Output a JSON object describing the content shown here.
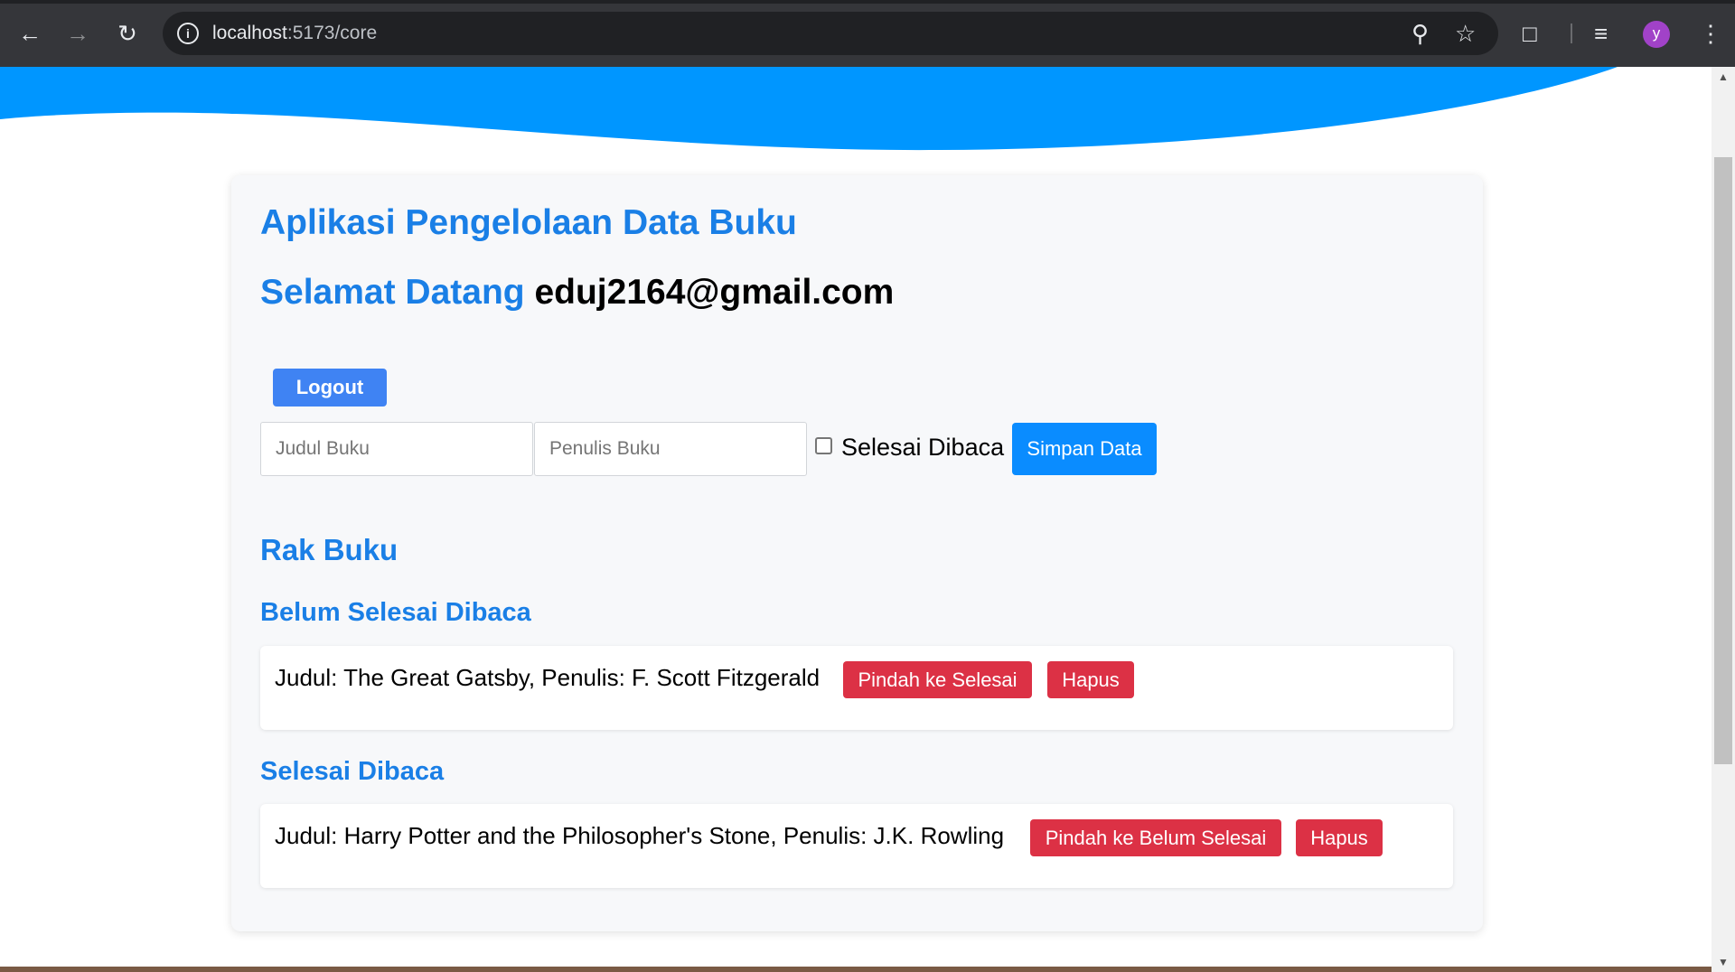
{
  "browser": {
    "url_host": "localhost",
    "url_path": ":5173/core",
    "profile_initial": "y",
    "icons": [
      "back-icon",
      "forward-icon",
      "reload-icon",
      "site-info-icon",
      "zoom-icon",
      "bookmark-star-icon",
      "extensions-icon",
      "media-controls-icon",
      "menu-icon"
    ]
  },
  "colors": {
    "accent": "#1a7fe6",
    "wave": "#0096ff",
    "primary_button": "#0a8cff",
    "logout_button": "#3f83f3",
    "danger_button": "#dc3145"
  },
  "app": {
    "title": "Aplikasi Pengelolaan Data Buku",
    "welcome_label": "Selamat Datang",
    "user_email": "eduj2164@gmail.com",
    "logout_label": "Logout"
  },
  "form": {
    "title_placeholder": "Judul Buku",
    "author_placeholder": "Penulis Buku",
    "finished_label": "Selesai Dibaca",
    "finished_checked": false,
    "save_label": "Simpan Data"
  },
  "shelf": {
    "heading": "Rak Buku",
    "unfinished": {
      "heading": "Belum Selesai Dibaca",
      "books": [
        {
          "text": "Judul: The Great Gatsby, Penulis: F. Scott Fitzgerald",
          "move_label": "Pindah ke Selesai",
          "delete_label": "Hapus"
        }
      ]
    },
    "finished": {
      "heading": "Selesai Dibaca",
      "books": [
        {
          "text": "Judul: Harry Potter and the Philosopher's Stone, Penulis: J.K. Rowling",
          "move_label": "Pindah ke Belum Selesai",
          "delete_label": "Hapus"
        }
      ]
    }
  }
}
